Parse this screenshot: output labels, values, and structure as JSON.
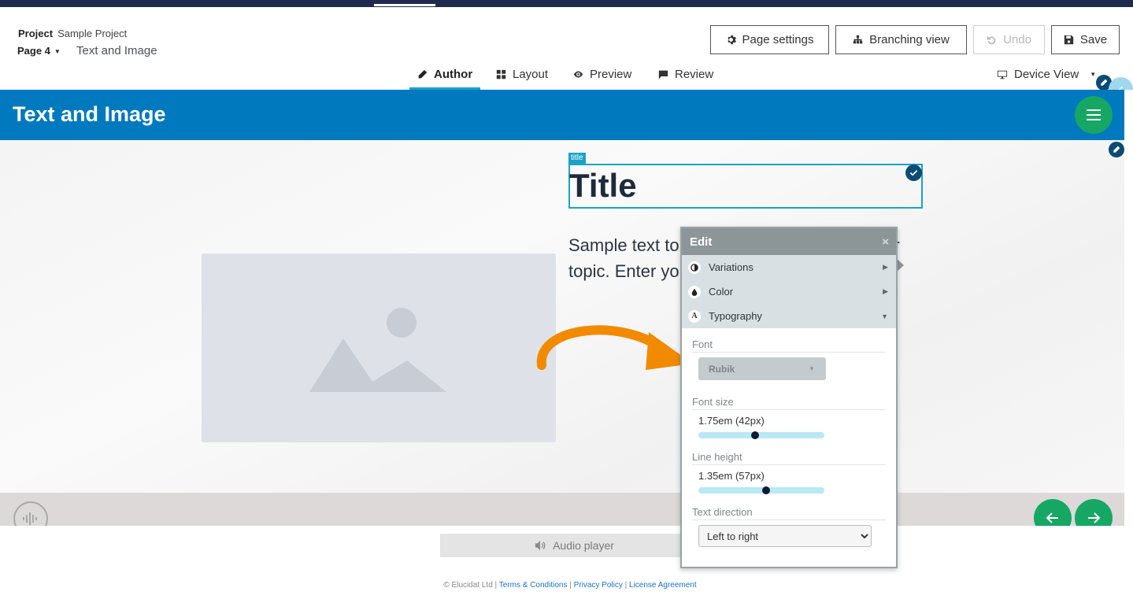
{
  "header": {
    "project_label": "Project",
    "project_name": "Sample Project",
    "page_label": "Page 4",
    "page_name": "Text and Image",
    "buttons": {
      "page_settings": "Page settings",
      "branching_view": "Branching view",
      "undo": "Undo",
      "save": "Save"
    }
  },
  "tabs": {
    "author": "Author",
    "layout": "Layout",
    "preview": "Preview",
    "review": "Review",
    "device_view": "Device View"
  },
  "stage": {
    "banner_title": "Text and Image",
    "title_tag": "title",
    "title_text": "Title",
    "body_text": "Sample text to enrich your learners on your topic. Enter your text here as you wish.",
    "audio_player": "Audio player"
  },
  "edit_panel": {
    "header": "Edit",
    "close": "×",
    "sections": {
      "variations": "Variations",
      "color": "Color",
      "typography": "Typography"
    },
    "font_label": "Font",
    "font_value": "Rubik",
    "font_size_label": "Font size",
    "font_size_value": "1.75em (42px)",
    "font_size_position": 0.45,
    "line_height_label": "Line height",
    "line_height_value": "1.35em (57px)",
    "line_height_position": 0.54,
    "text_direction_label": "Text direction",
    "text_direction_value": "Left to right"
  },
  "footer": {
    "copyright": "© Elucidat Ltd",
    "terms": "Terms & Conditions",
    "privacy": "Privacy Policy",
    "license": "License Agreement"
  },
  "colors": {
    "banner": "#0079bf",
    "accent_green": "#16a765",
    "selection": "#1aa3c8",
    "arrow": "#f28a00"
  },
  "icons": {
    "page_settings": "gear-icon",
    "branching_view": "sitemap-icon",
    "undo": "undo-icon",
    "save": "floppy-icon",
    "author": "pencil-icon",
    "layout": "grid-icon",
    "preview": "eye-icon",
    "review": "comment-icon",
    "device_view": "monitor-icon"
  }
}
